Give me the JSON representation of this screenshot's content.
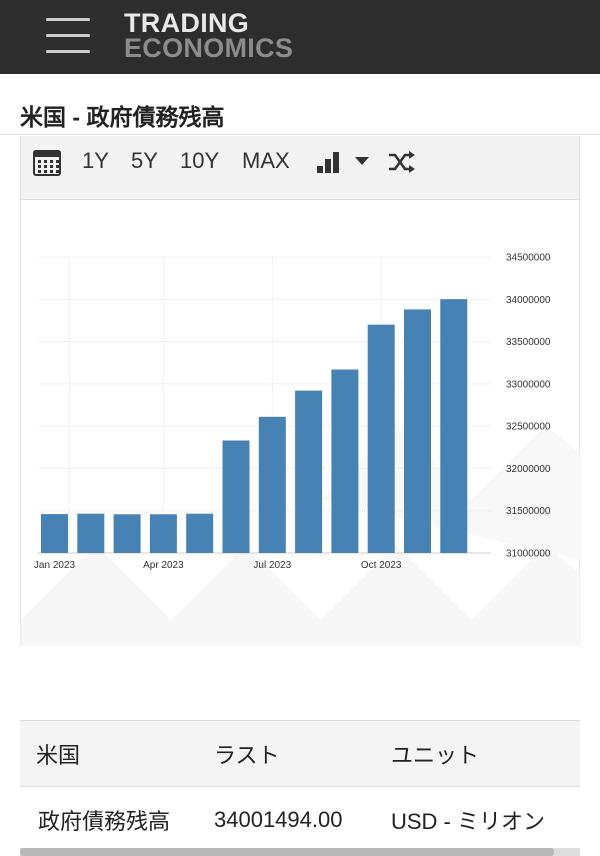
{
  "header": {
    "logo_line1": "TRADING",
    "logo_line2": "ECONOMICS",
    "menu_icon": "hamburger-menu-icon"
  },
  "page": {
    "title": "米国 - 政府債務残高"
  },
  "toolbar": {
    "calendar_icon": "calendar-icon",
    "ranges": [
      "1Y",
      "5Y",
      "10Y",
      "MAX"
    ],
    "chart_type_icon": "bar-chart-icon",
    "dropdown_icon": "caret-down-icon",
    "compare_icon": "shuffle-icon"
  },
  "chart_data": {
    "type": "bar",
    "title": "",
    "xlabel": "",
    "ylabel": "",
    "categories": [
      "Jan 2023",
      "Feb 2023",
      "Mar 2023",
      "Apr 2023",
      "May 2023",
      "Jun 2023",
      "Jul 2023",
      "Aug 2023",
      "Sep 2023",
      "Oct 2023",
      "Nov 2023",
      "Dec 2023"
    ],
    "values": [
      31460000,
      31465000,
      31458000,
      31458000,
      31465000,
      32330000,
      32610000,
      32920000,
      33170000,
      33700000,
      33880000,
      34001494
    ],
    "x_tick_labels": [
      "Jan 2023",
      "Apr 2023",
      "Jul 2023",
      "Oct 2023"
    ],
    "x_tick_indices": [
      0,
      3,
      6,
      9
    ],
    "y_ticks": [
      "31000000",
      "31500000",
      "32000000",
      "32500000",
      "33000000",
      "33500000",
      "34000000",
      "34500000"
    ],
    "ylim": [
      31000000,
      34500000
    ],
    "grid": true,
    "bar_color": "#4682b4"
  },
  "table": {
    "headers": [
      "米国",
      "ラスト",
      "ユニット"
    ],
    "row": [
      "政府債務残高",
      "34001494.00",
      "USD - ミリオン"
    ]
  }
}
